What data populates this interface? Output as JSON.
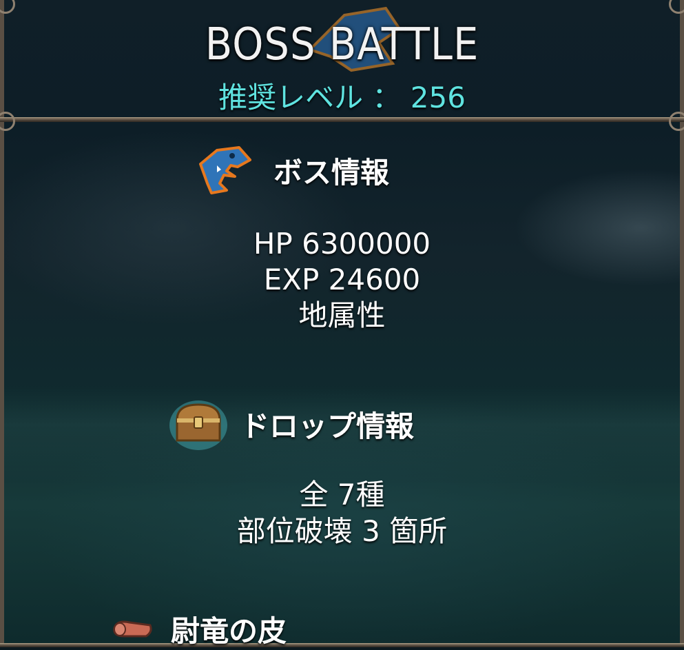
{
  "header": {
    "title": "BOSS  BATTLE",
    "recommended_level": "推奨レベル ： 256"
  },
  "boss_info": {
    "heading": "ボス情報",
    "icon": "shark-head-icon",
    "hp": "HP    6300000",
    "exp": "EXP    24600",
    "attribute": "地属性"
  },
  "drop_info": {
    "heading": "ドロップ情報",
    "icon": "treasure-chest-icon",
    "total": "全  7種",
    "breakable_parts": "部位破壊  3  箇所",
    "first_item": "尉竜の皮",
    "first_item_icon": "hide-scroll-icon"
  },
  "colors": {
    "accent_cyan": "#5fe3e0",
    "frame": "#5a4f44",
    "text": "#ffffff"
  }
}
